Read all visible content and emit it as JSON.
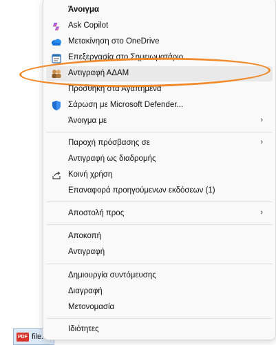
{
  "file": {
    "icon_label": "PDF",
    "name": "file."
  },
  "menu": {
    "items": [
      {
        "label": "Άνοιγμα",
        "icon": "none",
        "bold": true
      },
      {
        "label": "Ask Copilot",
        "icon": "copilot-icon"
      },
      {
        "label": "Μετακίνηση στο OneDrive",
        "icon": "onedrive-cloud-icon"
      },
      {
        "label": "Επεξεργασία στο Σημειωματάριο",
        "icon": "notepad-icon"
      },
      {
        "label": "Αντιγραφή ΑΔΑΜ",
        "icon": "two-people-icon"
      },
      {
        "label": "Προσθήκη στα Αγαπημένα",
        "icon": "none"
      },
      {
        "label": "Σάρωση με Microsoft Defender...",
        "icon": "defender-shield-icon"
      },
      {
        "label": "Άνοιγμα με",
        "icon": "none",
        "submenu": true
      },
      {
        "label": "Παροχή πρόσβασης σε",
        "icon": "none",
        "submenu": true
      },
      {
        "label": "Αντιγραφή ως διαδρομής",
        "icon": "none"
      },
      {
        "label": "Κοινή χρήση",
        "icon": "share-icon"
      },
      {
        "label": "Επαναφορά προηγούμενων εκδόσεων (1)",
        "icon": "none"
      },
      {
        "label": "Αποστολή προς",
        "icon": "none",
        "submenu": true
      },
      {
        "label": "Αποκοπή",
        "icon": "none"
      },
      {
        "label": "Αντιγραφή",
        "icon": "none"
      },
      {
        "label": "Δημιουργία συντόμευσης",
        "icon": "none"
      },
      {
        "label": "Διαγραφή",
        "icon": "none"
      },
      {
        "label": "Μετονομασία",
        "icon": "none"
      },
      {
        "label": "Ιδιότητες",
        "icon": "none"
      }
    ],
    "chevron": "›"
  },
  "colors": {
    "annotation": "#f08a2b",
    "menu_bg": "#f9f9f9",
    "hover_bg": "#e9e9e9"
  }
}
